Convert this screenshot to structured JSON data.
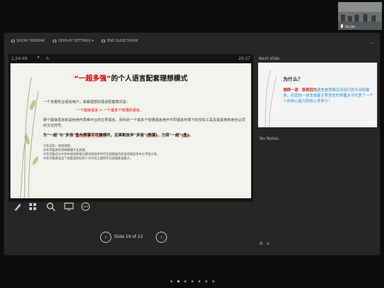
{
  "toolbar": {
    "show_taskbar": "SHOW TASKBAR",
    "display_settings": "DISPLAY SETTINGS ▾",
    "end_slideshow": "END SLIDE SHOW",
    "more": "···"
  },
  "timer": {
    "elapsed": "1:24:48",
    "clock": "20:27"
  },
  "slide": {
    "title_pre": "“一超多强”",
    "title_post": "的个人语言配套理想模式",
    "line1": "一个非服务业语言用户，其最理想的语言配套模式是：",
    "line2": "一个超级语言 + 一个或多个较强的语言。",
    "line3": "那个超级语言就是他用作思维平台的主导语言。另外的一个或多个较强语言用作不同语言环境下的交际工具及其民族和身份认同的文化符号。",
    "line4_pre": "为“一超”与“多强”",
    "line4_hl": "鱼与熊掌不可兼得",
    "line4_mid": "时，应果断放弃“多强”",
    "line4_hl2": "(熊掌)",
    "line4_post": "，力保“一超”",
    "line4_hl3": "(鱼)",
    "line4_end": "。",
    "note1": "只有这样，他或者她，",
    "note2": "才有可能具有清晰敏捷大化思维，",
    "note3": "才有可能成为今后中国创新能力建设和进步时代在国际国内各类领域竞争中之不败之地，",
    "note4": "才有可能建设这个高度国际化的人才市场上取得作为高素质家能力。"
  },
  "navigation": {
    "counter": "Slide 19 of 22",
    "prev": "‹",
    "next": "›"
  },
  "next_slide": {
    "label": "Next slide",
    "title": "为什么？",
    "body_red": "兼顾一语：",
    "body_red2": "那是因为",
    "body_blue": "语言是思维活动运行的平台和载体，对其他一语言或者主导语言的掌握水平代表了一个人的核心能力和核心竞争力！"
  },
  "notes": {
    "text": "No Notes."
  },
  "font_buttons": {
    "larger": "A",
    "smaller": "A"
  },
  "video": {
    "name": "Xu Jie"
  },
  "colors": {
    "accent_red": "#d00000",
    "accent_blue": "#1c8fd8",
    "highlight": "#f7c9a9"
  }
}
